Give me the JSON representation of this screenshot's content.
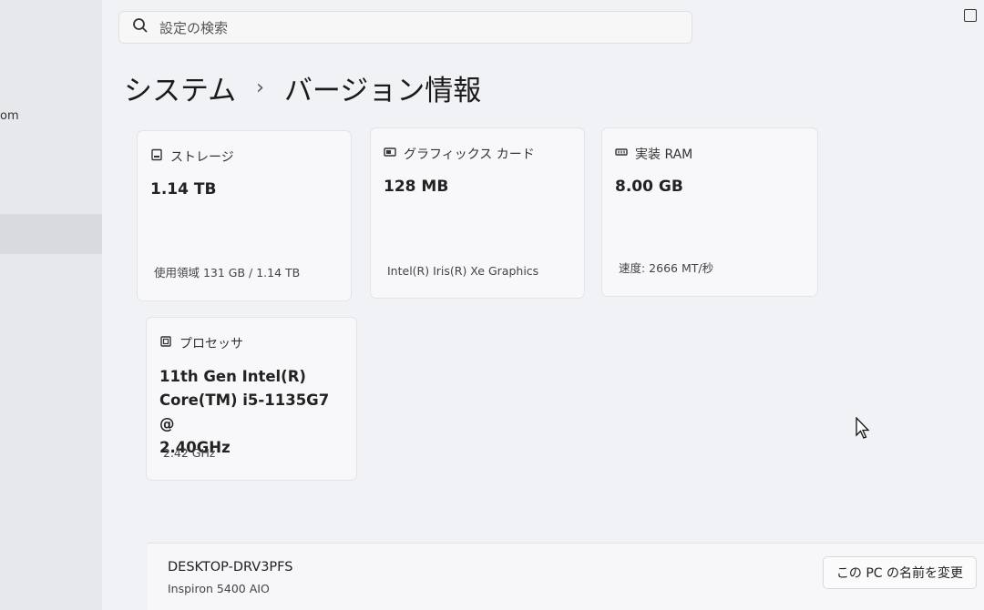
{
  "sidebar": {
    "fragment_text": "om"
  },
  "search": {
    "placeholder": "設定の検索"
  },
  "breadcrumb": {
    "parent": "システム",
    "separator": "›",
    "current": "バージョン情報"
  },
  "cards": {
    "storage": {
      "title": "ストレージ",
      "value": "1.14 TB",
      "sub": "使用領域 131 GB / 1.14 TB"
    },
    "graphics": {
      "title": "グラフィックス カード",
      "value": "128 MB",
      "sub": "Intel(R) Iris(R) Xe Graphics"
    },
    "ram": {
      "title": "実装 RAM",
      "value": "8.00 GB",
      "sub": "速度: 2666 MT/秒"
    },
    "processor": {
      "title": "プロセッサ",
      "value_lines": [
        "11th Gen Intel(R)",
        "Core(TM) i5-1135G7 @",
        "2.40GHz"
      ],
      "sub": "2.42 GHz"
    }
  },
  "device": {
    "name": "DESKTOP-DRV3PFS",
    "model": "Inspiron 5400 AIO",
    "rename_label": "この PC の名前を変更"
  }
}
